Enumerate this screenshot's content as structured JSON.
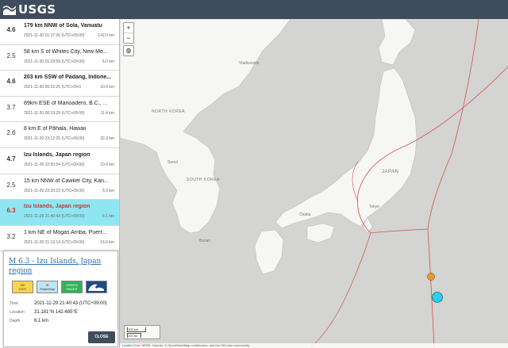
{
  "header": {
    "logo_text": "USGS"
  },
  "events": [
    {
      "mag": "4.6",
      "place": "179 km NNW of Sola, Vanuatu",
      "time": "2021-11-30 01:37:26 (UTC+09:00)",
      "depth": "142.0 km",
      "bold": true
    },
    {
      "mag": "2.5",
      "place": "58 km S of Whites City, New Me...",
      "time": "2021-11-30 01:33:59 (UTC+09:00)",
      "depth": "5.0 km",
      "bold": false
    },
    {
      "mag": "4.6",
      "place": "203 km SSW of Padang, Indone...",
      "time": "2021-11-30 00:22:25 (UTC+09:0",
      "depth": "10.0 km",
      "bold": true
    },
    {
      "mag": "3.7",
      "place": "89km ESE of Manoadero, B.C., ...",
      "time": "2021-11-30 00:19:29 (UTC+09:00)",
      "depth": "11.4 km",
      "bold": false
    },
    {
      "mag": "2.6",
      "place": "8 km E of Pāhala, Hawaii",
      "time": "2021-11-29 23:12:25 (UTC+09:00)",
      "depth": "32.3 km",
      "bold": false
    },
    {
      "mag": "4.7",
      "place": "Izu Islands, Japan region",
      "time": "2021-11-29 22:50:54 (UTC+09:00)",
      "depth": "10.0 km",
      "bold": true
    },
    {
      "mag": "2.5",
      "place": "15 km NNW of Cawker City, Kan...",
      "time": "2021-11-29 22:20:23 (UTC+09:00)",
      "depth": "5.0 km",
      "bold": false
    },
    {
      "mag": "6.3",
      "place": "Izu Islands, Japan region",
      "time": "2021-11-29 21:40:43 (UTC+09:00)",
      "depth": "6.1 km",
      "bold": true,
      "selected": true
    },
    {
      "mag": "3.2",
      "place": "1 km NE of Mogas Arriba, Puert...",
      "time": "2021-11-29 21:13:14 (UTC+09:00)",
      "depth": "15.0 km",
      "bold": false
    }
  ],
  "map": {
    "zoom_in": "+",
    "zoom_out": "−",
    "globe": "◍",
    "labels": {
      "vladivostok": "Vladivostok",
      "north_korea": "NORTH KOREA",
      "south_korea": "SOUTH KOREA",
      "japan": "JAPAN",
      "seoul": "Seoul",
      "tokyo": "Tokyo",
      "busan": "Busan",
      "osaka": "Osaka"
    },
    "scale_km": "100 km",
    "scale_mi": "100 mi",
    "attribution_link": "Leaflet",
    "attribution": "| Esri, HERE, Garmin, © OpenStreetMap contributors, and the GIS user community",
    "colors": {
      "selected_marker": "#22d3f0",
      "other_marker": "#f59a1f",
      "plate_boundary": "#d05050"
    }
  },
  "popup": {
    "title": "M 6.3 - Izu Islands, Japan region",
    "badges": {
      "dyfi_1": "VIII",
      "dyfi_2": "DYFI",
      "shake_1": "III",
      "shake_2": "ShakeMap",
      "pager_1": "GREEN",
      "pager_2": "PAGER"
    },
    "time_label": "Time",
    "time_value": "2021-11-29 21:40:43 (UTC+09:00)",
    "location_label": "Location",
    "location_value": "31.181°N 142.485°E",
    "depth_label": "Depth",
    "depth_value": "6.1 km",
    "close_label": "CLOSE"
  }
}
